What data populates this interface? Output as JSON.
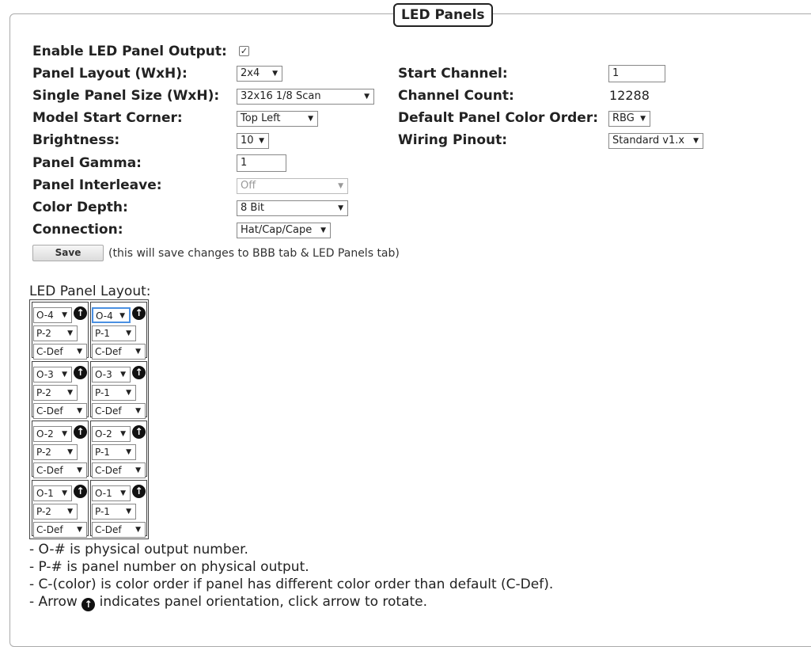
{
  "section_title": "LED Panels",
  "left_fields": {
    "enable_label": "Enable LED Panel Output:",
    "enable_checked": true,
    "layout_label": "Panel Layout (WxH):",
    "layout_value": "2x4",
    "size_label": "Single Panel Size (WxH):",
    "size_value": "32x16 1/8 Scan",
    "corner_label": "Model Start Corner:",
    "corner_value": "Top Left",
    "brightness_label": "Brightness:",
    "brightness_value": "10",
    "gamma_label": "Panel Gamma:",
    "gamma_value": "1",
    "interleave_label": "Panel Interleave:",
    "interleave_value": "Off",
    "depth_label": "Color Depth:",
    "depth_value": "8 Bit",
    "connection_label": "Connection:",
    "connection_value": "Hat/Cap/Cape"
  },
  "right_fields": {
    "start_label": "Start Channel:",
    "start_value": "1",
    "count_label": "Channel Count:",
    "count_value": "12288",
    "color_order_label": "Default Panel Color Order:",
    "color_order_value": "RBG",
    "wiring_label": "Wiring Pinout:",
    "wiring_value": "Standard v1.x"
  },
  "save": {
    "label": "Save",
    "hint": "(this will save changes to BBB tab & LED Panels tab)"
  },
  "layout_title": "LED Panel Layout:",
  "grid": {
    "arrow_glyph": "↑",
    "dropdown_glyph": "▼",
    "cells": [
      {
        "o": "O-4",
        "p": "P-2",
        "c": "C-Def"
      },
      {
        "o": "O-4",
        "p": "P-1",
        "c": "C-Def"
      },
      {
        "o": "O-3",
        "p": "P-2",
        "c": "C-Def"
      },
      {
        "o": "O-3",
        "p": "P-1",
        "c": "C-Def"
      },
      {
        "o": "O-2",
        "p": "P-2",
        "c": "C-Def"
      },
      {
        "o": "O-2",
        "p": "P-1",
        "c": "C-Def"
      },
      {
        "o": "O-1",
        "p": "P-2",
        "c": "C-Def"
      },
      {
        "o": "O-1",
        "p": "P-1",
        "c": "C-Def"
      }
    ]
  },
  "notes": {
    "line1": "- O-# is physical output number.",
    "line2": "- P-# is panel number on physical output.",
    "line3": "- C-(color) is color order if panel has different color order than default (C-Def).",
    "line4_before": "- Arrow",
    "line4_after": "indicates panel orientation, click arrow to rotate."
  }
}
